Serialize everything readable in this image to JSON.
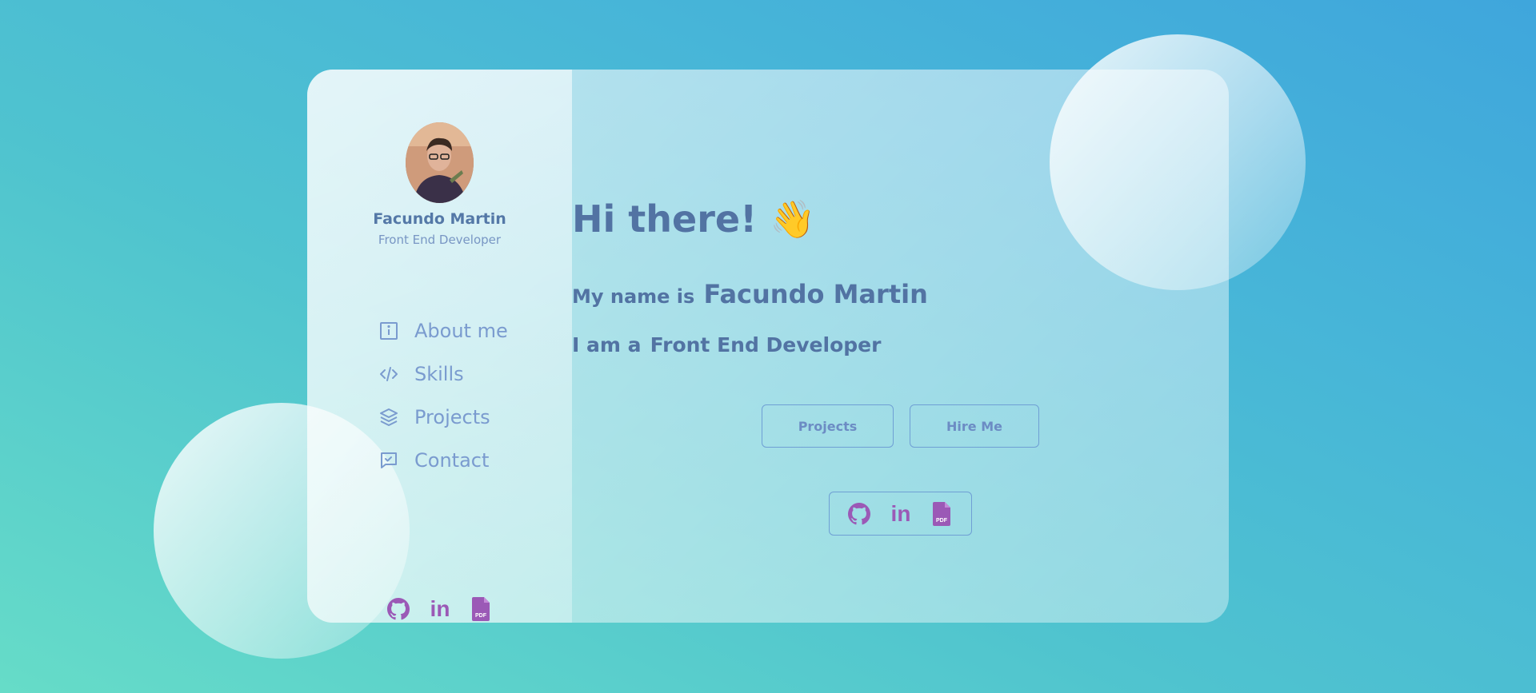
{
  "profile": {
    "name": "Facundo Martin",
    "role": "Front End Developer"
  },
  "nav": {
    "items": [
      {
        "label": "About me",
        "icon": "info-icon"
      },
      {
        "label": "Skills",
        "icon": "code-icon"
      },
      {
        "label": "Projects",
        "icon": "layers-icon"
      },
      {
        "label": "Contact",
        "icon": "chat-icon"
      }
    ]
  },
  "social": {
    "icons": [
      "github-icon",
      "linkedin-icon",
      "pdf-file-icon"
    ],
    "pdf_label": "PDF",
    "linkedin_label": "in"
  },
  "hero": {
    "greeting": "Hi there! 👋",
    "name_prefix": "My name is",
    "name": "Facundo Martin",
    "role_prefix": "I am a",
    "role": "Front End Developer"
  },
  "buttons": {
    "projects_label": "Projects",
    "hire_label": "Hire Me"
  },
  "colors": {
    "text_primary": "#5273a3",
    "nav_text": "#7a9bcf",
    "icon_accent": "#9b59b6",
    "button_border": "#6f9fd4"
  }
}
